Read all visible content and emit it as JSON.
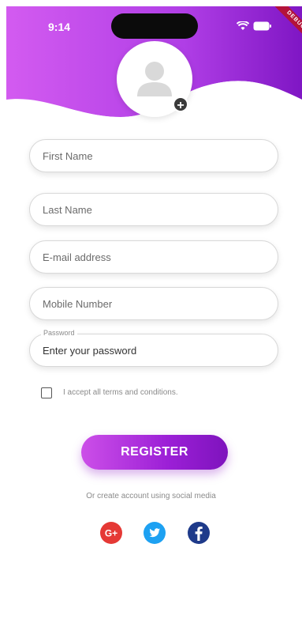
{
  "status_bar": {
    "time": "9:14"
  },
  "debug_banner": "DEBUG",
  "colors": {
    "accent_start": "#cc4fe8",
    "accent_end": "#7e13bd",
    "google": "#e53935",
    "twitter": "#1da1f2",
    "facebook": "#1e3a8a"
  },
  "form": {
    "first_name": {
      "placeholder": "First Name"
    },
    "last_name": {
      "placeholder": "Last Name"
    },
    "email": {
      "placeholder": "E-mail address"
    },
    "mobile": {
      "placeholder": "Mobile Number"
    },
    "password": {
      "label": "Password",
      "placeholder": "Enter your password"
    },
    "terms": "I accept all terms and conditions.",
    "register": "REGISTER",
    "alt_text": "Or create account using social media"
  },
  "social": [
    {
      "icon": "google-plus-icon",
      "label": "G+"
    },
    {
      "icon": "twitter-icon"
    },
    {
      "icon": "facebook-icon"
    }
  ]
}
